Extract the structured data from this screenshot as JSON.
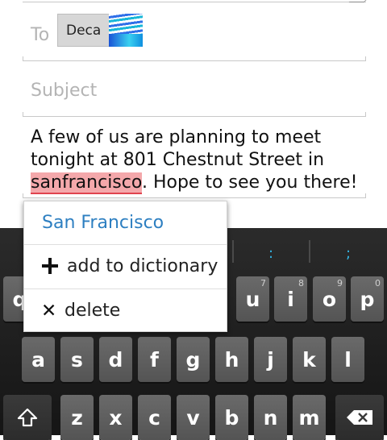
{
  "compose": {
    "to_label": "To",
    "recipient_name": "Deca",
    "subject_placeholder": "Subject",
    "body_before": "A few of us are planning to meet tonight at 801 Chestnut Street in ",
    "body_misspelled": "sanfrancisco",
    "body_after": ". Hope to see you there!"
  },
  "spell_popup": {
    "suggestion": "San Francisco",
    "add_label": "add to dictionary",
    "delete_label": "delete"
  },
  "keyboard": {
    "suggestion_strip": [
      ":",
      ";"
    ],
    "row1": [
      {
        "label": "q",
        "hint": ""
      },
      {
        "label": "u",
        "hint": "7"
      },
      {
        "label": "i",
        "hint": "8"
      },
      {
        "label": "o",
        "hint": "9"
      },
      {
        "label": "p",
        "hint": "0"
      }
    ],
    "row2": [
      "a",
      "s",
      "d",
      "f",
      "g",
      "h",
      "j",
      "k",
      "l"
    ],
    "row3": [
      "z",
      "x",
      "c",
      "v",
      "b",
      "n",
      "m"
    ],
    "shift_icon": "shift-arrow-icon",
    "backspace_icon": "backspace-icon"
  },
  "colors": {
    "suggestion_blue": "#2d7fc1",
    "holo_blue": "#33b5e5",
    "misspell_highlight": "#f4a8ab"
  }
}
